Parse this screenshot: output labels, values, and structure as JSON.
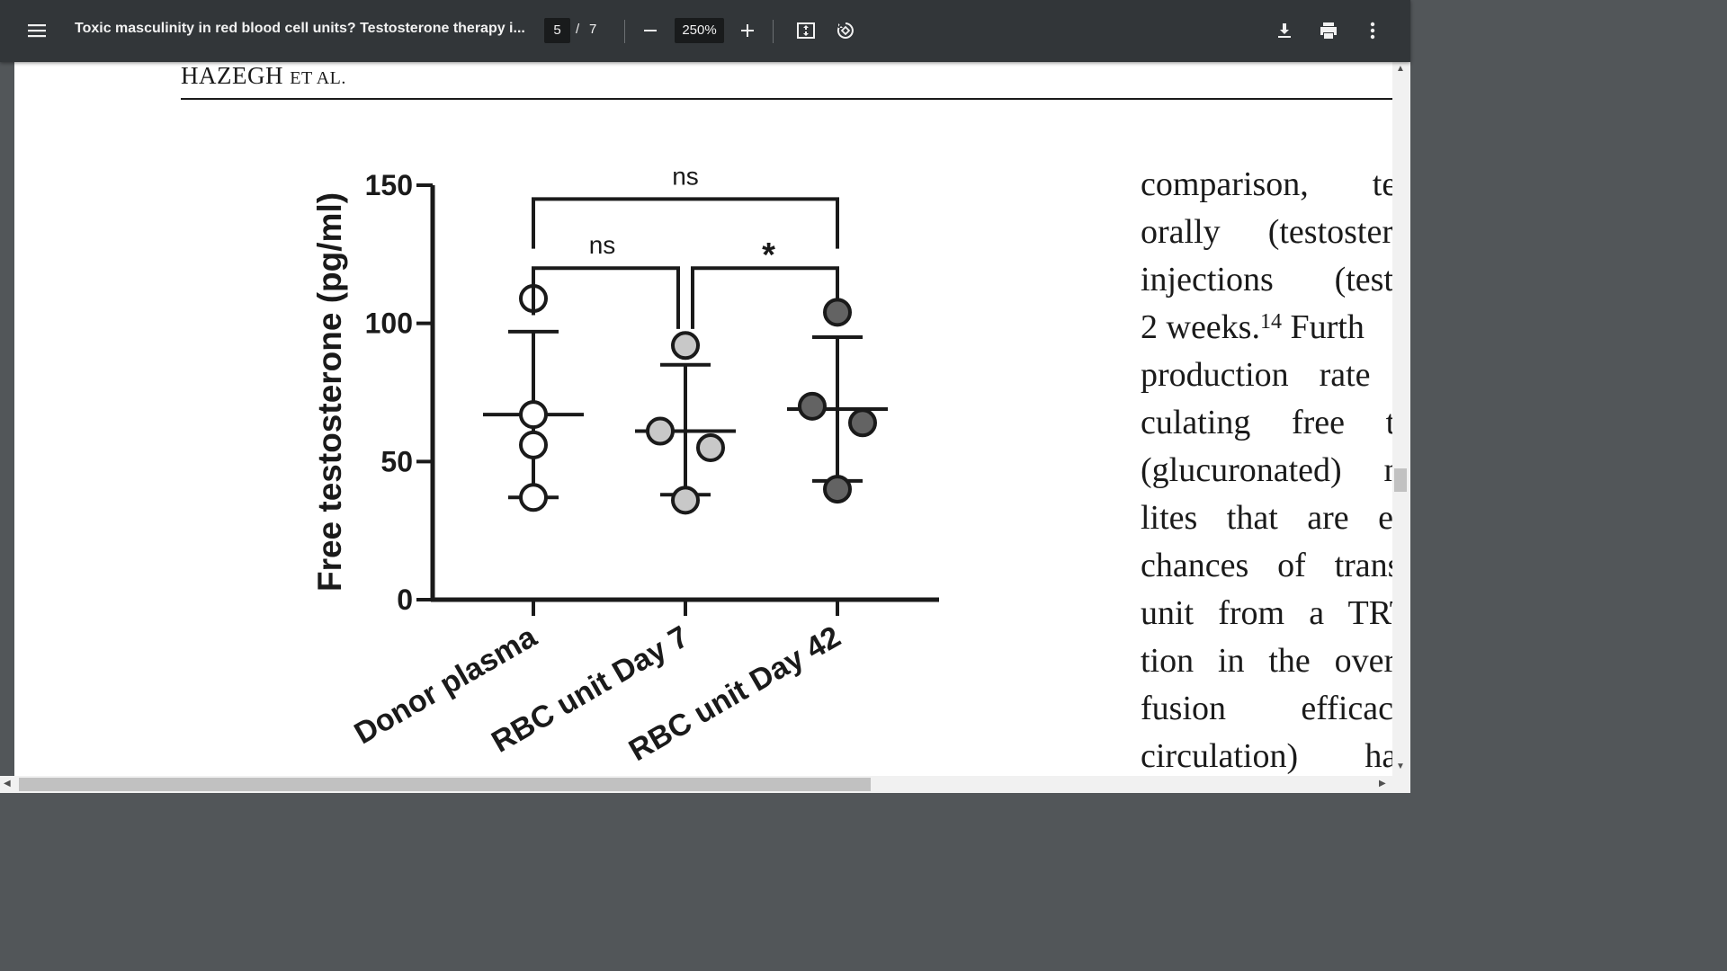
{
  "toolbar": {
    "menu_icon": "hamburger-menu-icon",
    "title": "Toxic masculinity in red blood cell units? Testosterone therapy i...",
    "page_current": "5",
    "page_separator": "/",
    "page_total": "7",
    "zoom": "250%",
    "icons": [
      "zoom-out-icon",
      "zoom-in-icon",
      "fit-page-icon",
      "rotate-icon",
      "download-icon",
      "print-icon",
      "more-options-icon"
    ]
  },
  "document": {
    "running_head_main": "HAZEGH",
    "running_head_small": "ET AL.",
    "body_lines": [
      "comparison, tes",
      "orally (testostero",
      "injections (testo",
      "2 weeks.",
      "production rate i",
      "culating free te",
      "(glucuronated) m",
      "lites that are ex",
      "chances of transi",
      "unit from a TRT",
      "tion in the overa",
      "fusion efficacy",
      "circulation) has"
    ],
    "superscript": "14",
    "line4_tail": " Furth"
  },
  "chart_data": {
    "type": "scatter",
    "ylabel": "Free testosterone (pg/ml)",
    "xlabel": "",
    "ylim": [
      0,
      150
    ],
    "yticks": [
      0,
      50,
      100,
      150
    ],
    "categories": [
      "Donor plasma",
      "RBC unit Day 7",
      "RBC unit Day 42"
    ],
    "series": [
      {
        "points": [
          109,
          67,
          56,
          37
        ],
        "mean": 67,
        "upper": 97,
        "lower": 37,
        "fill": "#ffffff"
      },
      {
        "points": [
          92,
          61,
          55,
          36
        ],
        "mean": 61,
        "upper": 85,
        "lower": 38,
        "fill": "#c8c8c8"
      },
      {
        "points": [
          104,
          70,
          64,
          40
        ],
        "mean": 69,
        "upper": 95,
        "lower": 43,
        "fill": "#636363"
      }
    ],
    "annotations": [
      {
        "label": "ns",
        "between": [
          "Donor plasma",
          "RBC unit Day 42"
        ]
      },
      {
        "label": "ns",
        "between": [
          "Donor plasma",
          "RBC unit Day 7"
        ]
      },
      {
        "label": "*",
        "between": [
          "RBC unit Day 7",
          "RBC unit Day 42"
        ]
      }
    ]
  }
}
